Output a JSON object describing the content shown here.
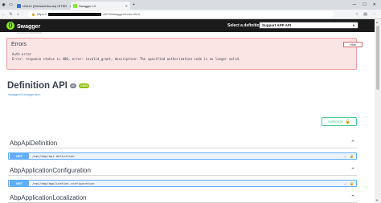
{
  "browser": {
    "tabs": [
      {
        "label": "LINUX (Debian/Ubuntu) ISTSR",
        "active": false
      },
      {
        "label": "Swagger UI",
        "active": true
      }
    ],
    "address": {
      "prefix": "https://",
      "suffix": "/4570/swagger/index.html"
    }
  },
  "swagger": {
    "logo_text": "Swagger",
    "logo_sub": "Supported by SMARTBEAR",
    "definition_label": "Select a definition",
    "definition_value": "Support APP API"
  },
  "errors": {
    "title": "Errors",
    "hide_label": "Hide",
    "line1": "Auth error",
    "line2": "Error: response status is 400, error: invalid_grant, description: The specified authorization code is no longer valid."
  },
  "info": {
    "title": "Definition API",
    "version": "v1",
    "oas": "OAS3",
    "json_link": "/swagger/v1/swagger.json"
  },
  "authorize_label": "Authorize",
  "sections": [
    {
      "name": "AbpApiDefinition",
      "ops": [
        {
          "method": "GET",
          "path": "/api/abp/api-definition"
        }
      ]
    },
    {
      "name": "AbpApplicationConfiguration",
      "ops": [
        {
          "method": "GET",
          "path": "/api/abp/application-configuration"
        }
      ]
    },
    {
      "name": "AbpApplicationLocalization",
      "ops": []
    }
  ],
  "colors": {
    "get_accent": "#61affe",
    "authorize": "#49cc90",
    "topbar": "#1b1b1b",
    "error_bg": "#fbe4e4"
  }
}
